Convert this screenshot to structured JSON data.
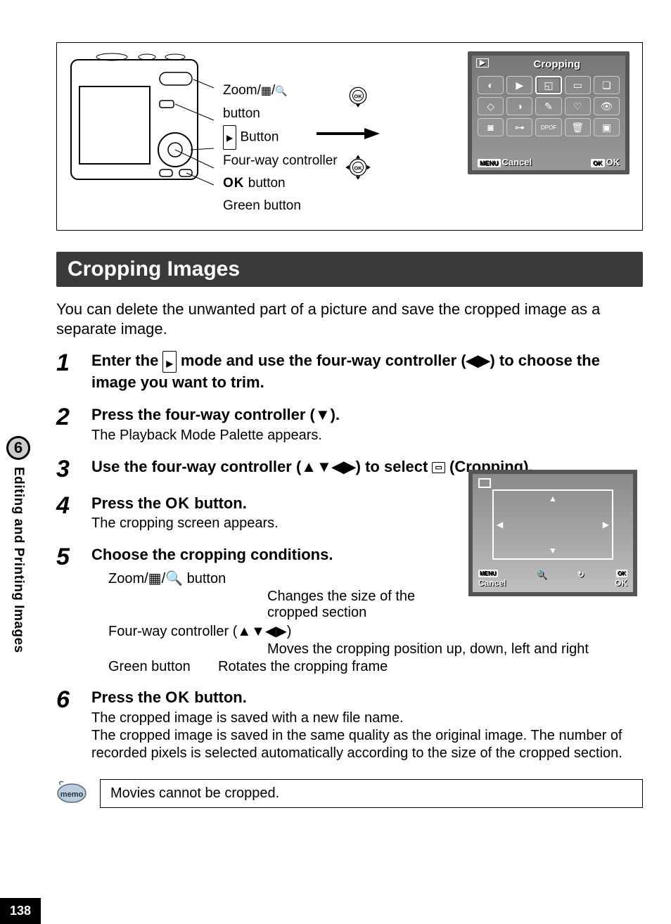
{
  "chapter_number": "6",
  "chapter_title": "Editing and Printing Images",
  "page_number": "138",
  "diagram": {
    "zoom_label": "Zoom/",
    "zoom_label2": "button",
    "play_button_label": " Button",
    "fourway_label": "Four-way controller",
    "ok_label_prefix": "OK",
    "ok_label_suffix": " button",
    "green_label": "Green button"
  },
  "palette": {
    "title": "Cropping",
    "cancel_label": "Cancel",
    "menu_tag": "MENU",
    "ok_tag": "OK",
    "ok_label": "OK"
  },
  "section_title": "Cropping Images",
  "intro": "You can delete the unwanted part of a picture and save the cropped image as a separate image.",
  "steps": {
    "s1": {
      "num": "1",
      "title_a": "Enter the ",
      "title_b": " mode and use the four-way controller (◀▶) to choose the image you want to trim."
    },
    "s2": {
      "num": "2",
      "title": "Press the four-way controller (▼).",
      "sub": "The Playback Mode Palette appears."
    },
    "s3": {
      "num": "3",
      "title_a": "Use the four-way controller (▲▼◀▶) to select ",
      "title_b": " (Cropping)."
    },
    "s4": {
      "num": "4",
      "title_a": "Press the ",
      "title_ok": "OK",
      "title_b": " button.",
      "sub": "The cropping screen appears."
    },
    "s5": {
      "num": "5",
      "title": "Choose the cropping conditions.",
      "cond1_label": "Zoom/▦/🔍 button",
      "cond1_desc": "Changes the size of the cropped section",
      "cond2_label": "Four-way controller (▲▼◀▶)",
      "cond2_desc": "Moves the cropping position up, down, left and right",
      "cond3_label": "Green button",
      "cond3_desc": "Rotates the cropping frame"
    },
    "s6": {
      "num": "6",
      "title_a": "Press the ",
      "title_ok": "OK",
      "title_b": " button.",
      "sub": "The cropped image is saved with a new file name.\nThe cropped image is saved in the same quality as the original image. The number of recorded pixels is selected automatically according to the size of the cropped section."
    }
  },
  "crop_screen": {
    "menu_tag": "MENU",
    "cancel": "Cancel",
    "ok_tag": "OK",
    "ok": "OK"
  },
  "memo": "Movies cannot be cropped."
}
